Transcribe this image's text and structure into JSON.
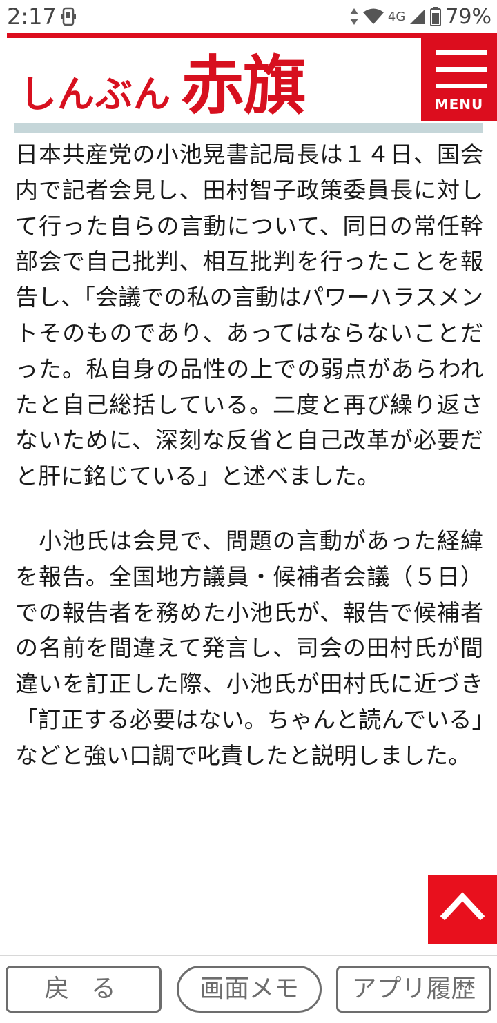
{
  "status_bar": {
    "time": "2:17",
    "network": "4G",
    "battery": "79%"
  },
  "header": {
    "logo_small": "しんぶん",
    "logo_big": "赤旗",
    "menu_label": "MENU"
  },
  "article": {
    "paragraphs": [
      "日本共産党の小池晃書記局長は１４日、国会内で記者会見し、田村智子政策委員長に対して行った自らの言動について、同日の常任幹部会で自己批判、相互批判を行ったことを報告し、「会議での私の言動はパワーハラスメントそのものであり、あってはならないことだった。私自身の品性の上での弱点があらわれたと自己総括している。二度と再び繰り返さないために、深刻な反省と自己改革が必要だと肝に銘じている」と述べました。",
      "　小池氏は会見で、問題の言動があった経緯を報告。全国地方議員・候補者会議（５日）での報告者を務めた小池氏が、報告で候補者の名前を間違えて発言し、司会の田村氏が間違いを訂正した際、小池氏が田村氏に近づき「訂正する必要はない。ちゃんと読んでいる」などと強い口調で叱責したと説明しました。"
    ]
  },
  "bottom_bar": {
    "back_label": "戻 る",
    "memo_label": "画面メモ",
    "history_label": "アプリ履歴"
  },
  "colors": {
    "brand_red": "#dc0d1e",
    "divider": "#c5d6d9",
    "button_gray": "#6d6d6d"
  },
  "icons": {
    "menu": "hamburger-icon",
    "scroll_top": "chevron-up-icon"
  }
}
